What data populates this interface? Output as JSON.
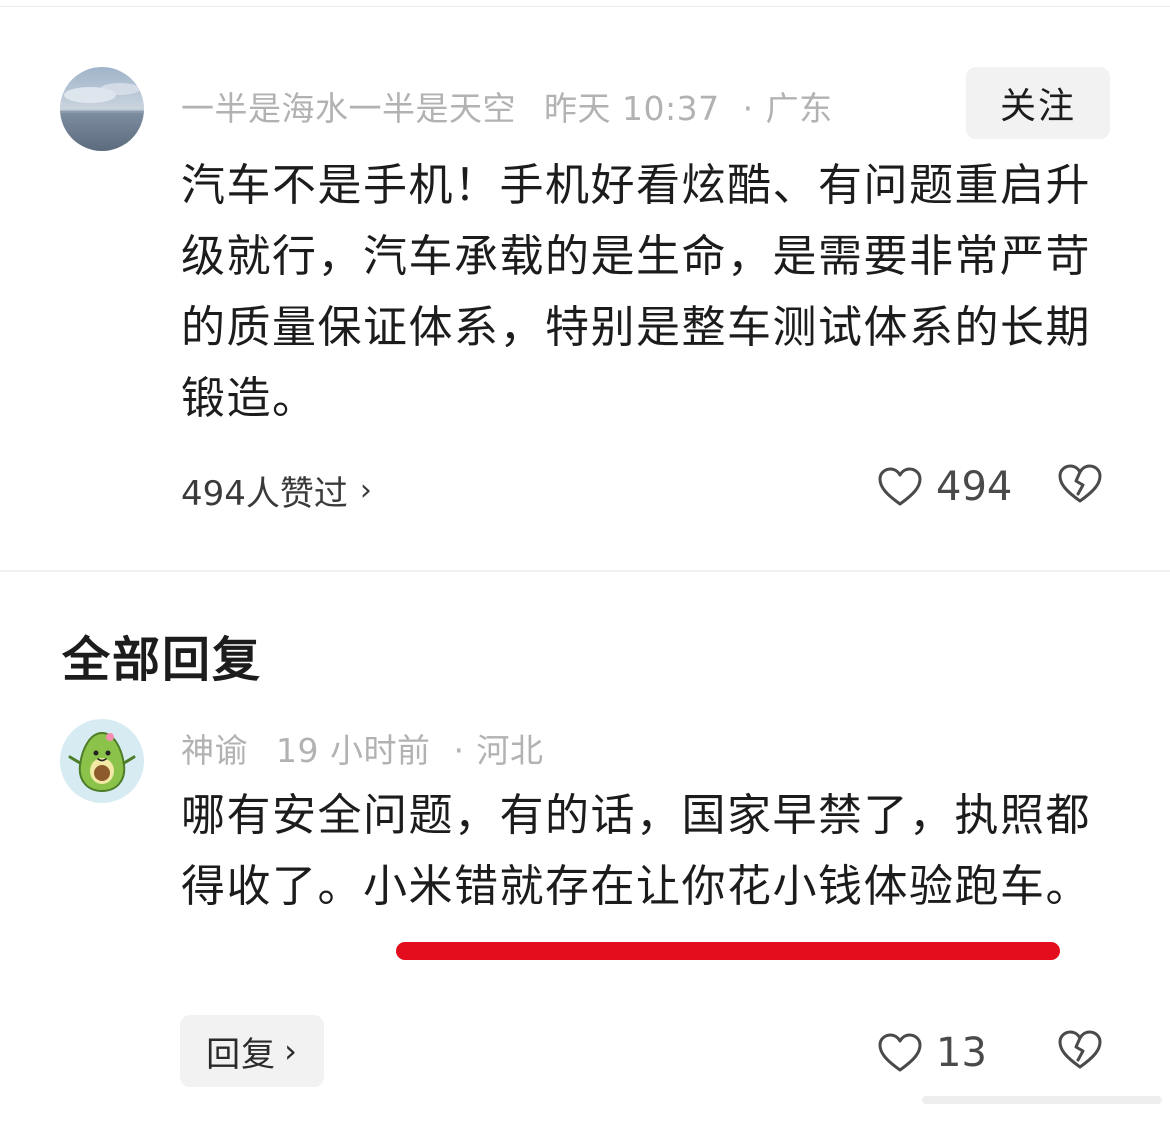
{
  "main_comment": {
    "username": "一半是海水一半是天空",
    "time": "昨天 10:37",
    "location_sep": "·",
    "location": "广东",
    "follow_label": "关注",
    "text": "汽车不是手机！手机好看炫酷、有问题重启升级就行，汽车承载的是生命，是需要非常严苛的质量保证体系，特别是整车测试体系的长期锻造。",
    "liked_by_label": "494人赞过",
    "like_count": "494"
  },
  "replies_section": {
    "title": "全部回复"
  },
  "reply": {
    "username": "神谕",
    "time": "19 小时前",
    "location_sep": "·",
    "location": "河北",
    "text": "哪有安全问题，有的话，国家早禁了，执照都得收了。小米错就存在让你花小钱体验跑车。",
    "reply_label": "回复",
    "like_count": "13"
  },
  "icons": {
    "like": "heart-outline-icon",
    "dislike": "broken-heart-icon",
    "chevron": "chevron-right-icon"
  },
  "colors": {
    "annotation_red": "#e30d1d",
    "meta_gray": "#b2b2b2",
    "button_bg": "#f2f2f2"
  }
}
